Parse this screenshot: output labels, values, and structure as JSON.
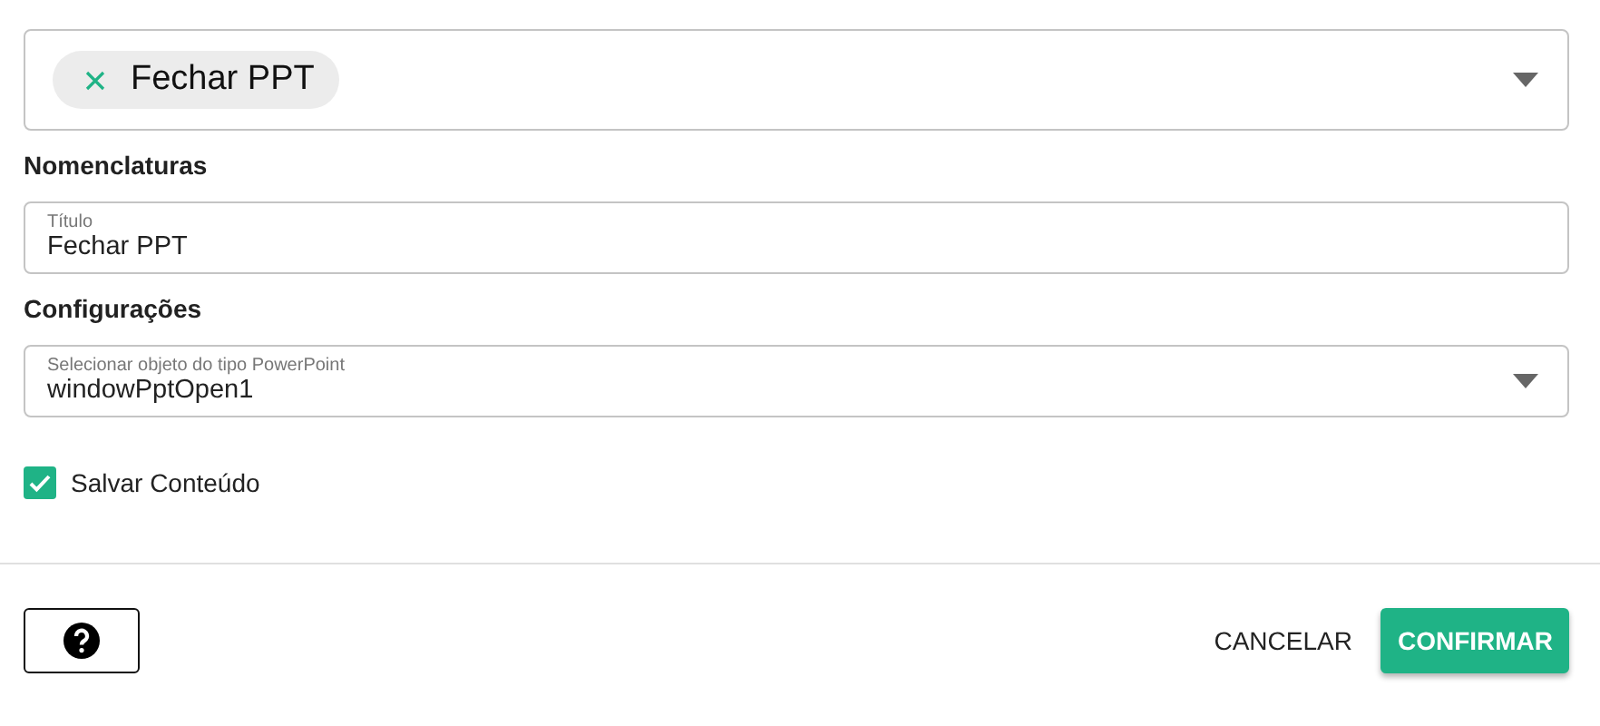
{
  "action_select": {
    "chip": {
      "label": "Fechar PPT"
    }
  },
  "sections": [
    {
      "heading": "Nomenclaturas",
      "fields": [
        {
          "kind": "text",
          "label": "Título",
          "value": "Fechar PPT"
        }
      ]
    },
    {
      "heading": "Configurações",
      "fields": [
        {
          "kind": "select",
          "label": "Selecionar objeto do tipo PowerPoint",
          "value": "windowPptOpen1"
        }
      ]
    }
  ],
  "options": [
    {
      "label": "Salvar Conteúdo",
      "checked": true
    }
  ],
  "footer": {
    "buttons": [
      {
        "kind": "text",
        "label": "CANCELAR"
      },
      {
        "kind": "primary",
        "label": "CONFIRMAR"
      }
    ]
  }
}
